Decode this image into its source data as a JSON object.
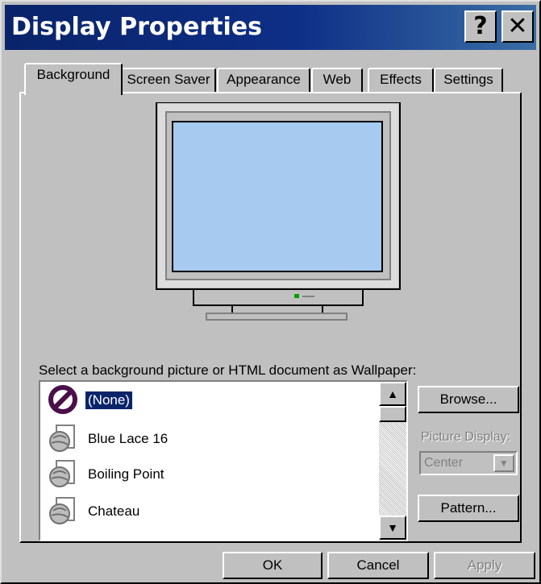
{
  "window": {
    "title": "Display Properties",
    "help_glyph": "?",
    "close_glyph": "✕"
  },
  "tabs": [
    {
      "label": "Background",
      "active": true
    },
    {
      "label": "Screen Saver",
      "active": false
    },
    {
      "label": "Appearance",
      "active": false
    },
    {
      "label": "Web",
      "active": false
    },
    {
      "label": "Effects",
      "active": false
    },
    {
      "label": "Settings",
      "active": false
    }
  ],
  "background_tab": {
    "wallpaper_label": "Select a background picture or HTML document as Wallpaper:",
    "wallpapers": [
      {
        "label": "(None)",
        "selected": true,
        "icon": "none-icon"
      },
      {
        "label": "Blue Lace 16",
        "selected": false,
        "icon": "html-document-icon"
      },
      {
        "label": "Boiling Point",
        "selected": false,
        "icon": "html-document-icon"
      },
      {
        "label": "Chateau",
        "selected": false,
        "icon": "html-document-icon"
      }
    ],
    "browse_button": "Browse...",
    "picture_display_label": "Picture Display:",
    "picture_display_value": "Center",
    "pattern_button": "Pattern..."
  },
  "footer": {
    "ok": "OK",
    "cancel": "Cancel",
    "apply": "Apply"
  },
  "colors": {
    "title_bar": "#0a246a",
    "face": "#c0c0c0",
    "preview_screen": "#a6caf0",
    "selection": "#0a246a"
  }
}
